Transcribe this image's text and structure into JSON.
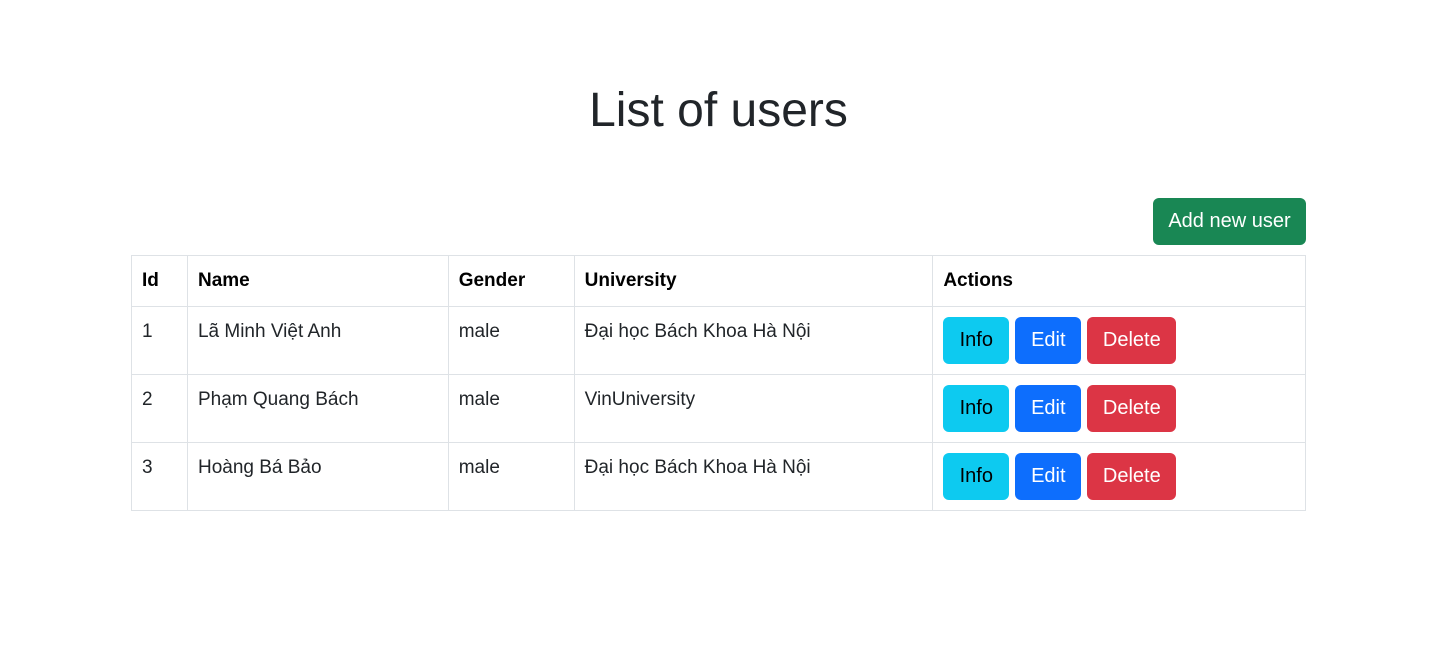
{
  "page": {
    "title": "List of users"
  },
  "toolbar": {
    "add_label": "Add new user"
  },
  "table": {
    "headers": {
      "id": "Id",
      "name": "Name",
      "gender": "Gender",
      "university": "University",
      "actions": "Actions"
    },
    "rows": [
      {
        "id": "1",
        "name": "Lã Minh Việt Anh",
        "gender": "male",
        "university": "Đại học Bách Khoa Hà Nội"
      },
      {
        "id": "2",
        "name": "Phạm Quang Bách",
        "gender": "male",
        "university": "VinUniversity"
      },
      {
        "id": "3",
        "name": "Hoàng Bá Bảo",
        "gender": "male",
        "university": "Đại học Bách Khoa Hà Nội"
      }
    ]
  },
  "actions": {
    "info_label": "Info",
    "edit_label": "Edit",
    "delete_label": "Delete"
  },
  "colors": {
    "add_button": "#198754",
    "info_button": "#0dcaf0",
    "edit_button": "#0d6efd",
    "delete_button": "#dc3545",
    "border": "#dee2e6",
    "text": "#212529"
  }
}
